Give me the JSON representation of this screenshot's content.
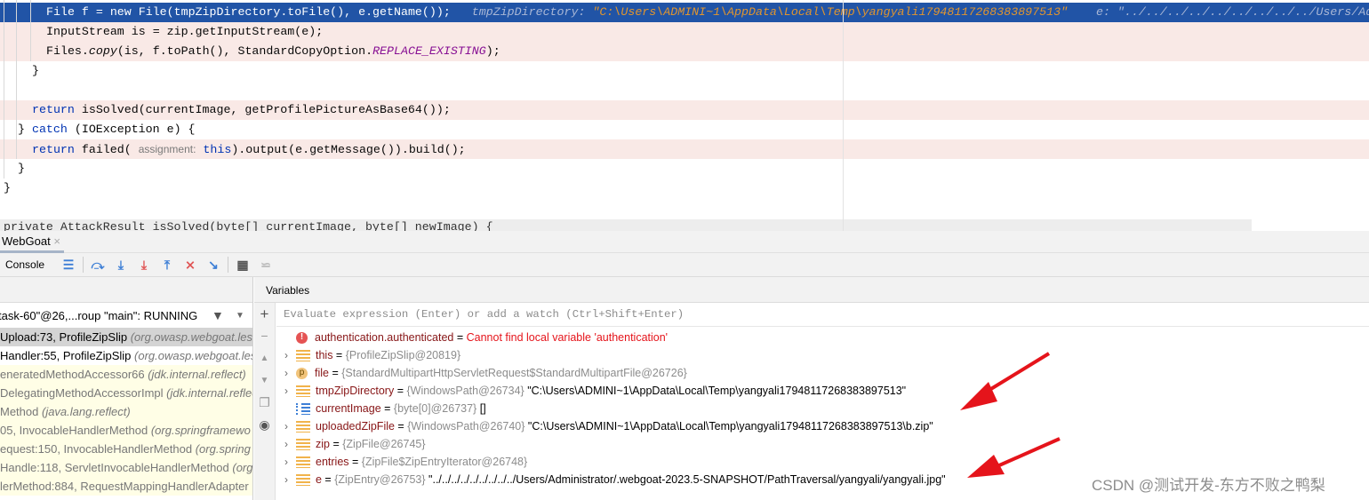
{
  "editor": {
    "lines": [
      {
        "code": "File f = new File(tmpZipDirectory.toFile(), e.getName());",
        "inline_hint_1_name": "tmpZipDirectory:",
        "inline_hint_1_value": "\"C:\\Users\\ADMINI~1\\AppData\\Local\\Temp\\yangyali17948117268383897513\"",
        "inline_hint_2": "e: \"../../../../../../../../../Users/Ad"
      },
      {
        "code": "InputStream is = zip.getInputStream(e);"
      },
      {
        "pre": "Files.",
        "method": "copy",
        "mid": "(is, f.toPath(), StandardCopyOption.",
        "const": "REPLACE_EXISTING",
        "post": ");"
      },
      {
        "code": "}"
      },
      {
        "kw": "return",
        "rest": " isSolved(currentImage, getProfilePictureAsBase64());"
      },
      {
        "pre": "} ",
        "kw": "catch",
        "rest": " (IOException e) {"
      },
      {
        "kw": "return",
        "rest1": " failed( ",
        "hint": "assignment:",
        "kw2": "this",
        "rest2": ").output(e.getMessage()).build();"
      },
      {
        "code": "}"
      },
      {
        "code": "}"
      },
      {
        "code": "private AttackResult isSolved(byte[] currentImage, byte[] newImage) {"
      }
    ]
  },
  "debug_tab": {
    "label": "WebGoat",
    "close": "×"
  },
  "toolbar": {
    "console_label": "Console"
  },
  "frames_panel": {
    "thread": "task-60\"@26,...roup \"main\": RUNNING",
    "frames": [
      {
        "name": "Upload:73, ProfileZipSlip ",
        "pkg": "(org.owasp.webgoat.less"
      },
      {
        "name": "Handler:55, ProfileZipSlip ",
        "pkg": "(org.owasp.webgoat.less"
      },
      {
        "name": "eneratedMethodAccessor66 ",
        "pkg": "(jdk.internal.reflect)"
      },
      {
        "name": "DelegatingMethodAccessorImpl ",
        "pkg": "(jdk.internal.reflec"
      },
      {
        "name": " Method ",
        "pkg": "(java.lang.reflect)"
      },
      {
        "name": "05, InvocableHandlerMethod ",
        "pkg": "(org.springframewo"
      },
      {
        "name": "equest:150, InvocableHandlerMethod ",
        "pkg": "(org.spring"
      },
      {
        "name": "Handle:118, ServletInvocableHandlerMethod ",
        "pkg": "(org."
      },
      {
        "name": "lerMethod:884, RequestMappingHandlerAdapter",
        "pkg": ""
      }
    ]
  },
  "variables_panel": {
    "title": "Variables",
    "watch_placeholder": "Evaluate expression (Enter) or add a watch (Ctrl+Shift+Enter)",
    "vars": [
      {
        "icon": "error",
        "name": "authentication.authenticated",
        "error": "Cannot find local variable 'authentication'"
      },
      {
        "icon": "field",
        "name": "this",
        "type": "{ProfileZipSlip@20819}",
        "value": ""
      },
      {
        "icon": "param",
        "name": "file",
        "type": "{StandardMultipartHttpServletRequest$StandardMultipartFile@26726}",
        "value": ""
      },
      {
        "icon": "field",
        "name": "tmpZipDirectory",
        "type": "{WindowsPath@26734}",
        "value": "\"C:\\Users\\ADMINI~1\\AppData\\Local\\Temp\\yangyali17948117268383897513\""
      },
      {
        "icon": "array",
        "name": "currentImage",
        "type": "{byte[0]@26737}",
        "value": "[]"
      },
      {
        "icon": "field",
        "name": "uploadedZipFile",
        "type": "{WindowsPath@26740}",
        "value": "\"C:\\Users\\ADMINI~1\\AppData\\Local\\Temp\\yangyali17948117268383897513\\b.zip\""
      },
      {
        "icon": "field",
        "name": "zip",
        "type": "{ZipFile@26745}",
        "value": ""
      },
      {
        "icon": "field",
        "name": "entries",
        "type": "{ZipFile$ZipEntryIterator@26748}",
        "value": ""
      },
      {
        "icon": "field",
        "name": "e",
        "type": "{ZipEntry@26753}",
        "value": "\"../../../../../../../../../Users/Administrator/.webgoat-2023.5-SNAPSHOT/PathTraversal/yangyali/yangyali.jpg\""
      }
    ]
  },
  "watermark": "CSDN @测试开发-东方不败之鸭梨",
  "colors": {
    "selection": "#2154a6",
    "breakpoint_line": "#f9e9e6",
    "arrow": "#e5141b"
  }
}
